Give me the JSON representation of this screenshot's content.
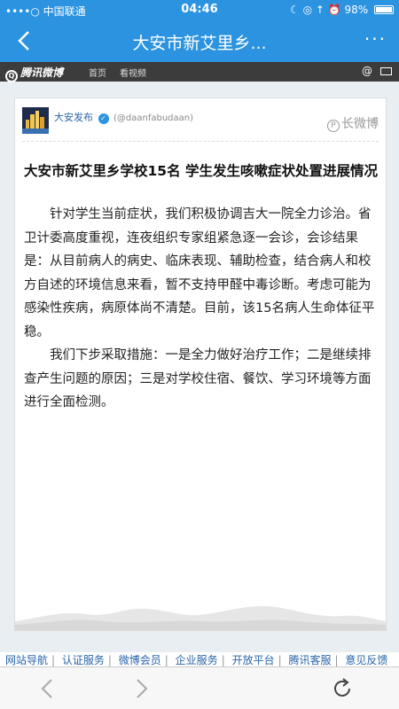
{
  "status_bar": {
    "carrier": "••••○ 中国联通",
    "time": "04:46",
    "battery": "98%",
    "battery_level": 0.98
  },
  "nav_bar": {
    "title": "大安市新艾里乡...",
    "more": "···"
  },
  "weibo_bar": {
    "logo": "腾讯微博",
    "nav_home": "首页",
    "nav_video": "看视频",
    "at": "@"
  },
  "post": {
    "author": "大安发布",
    "verified": "✓",
    "handle": "(@daanfabudaan)",
    "long_weibo_label": "长微博",
    "title": "大安市新艾里乡学校15名 学生发生咳嗽症状处置进展情况",
    "paragraphs": [
      "针对学生当前症状，我们积极协调吉大一院全力诊治。省卫计委高度重视，连夜组织专家组紧急逐一会诊，会诊结果是：从目前病人的病史、临床表现、辅助检查，结合病人和校方自述的环境信息来看，暂不支持甲醛中毒诊断。考虑可能为感染性疾病，病原体尚不清楚。目前，该15名病人生命体征平稳。",
      "我们下步采取措施：一是全力做好治疗工作；二是继续排查产生问题的原因；三是对学校住宿、餐饮、学习环境等方面进行全面检测。"
    ]
  },
  "footer_links": [
    "网站导航",
    "认证服务",
    "微博会员",
    "企业服务",
    "开放平台",
    "腾讯客服",
    "意见反馈"
  ],
  "colors": {
    "primary": "#2b93e0",
    "link": "#2a64a8",
    "weibo_bar_bg": "#3c3c3c"
  }
}
